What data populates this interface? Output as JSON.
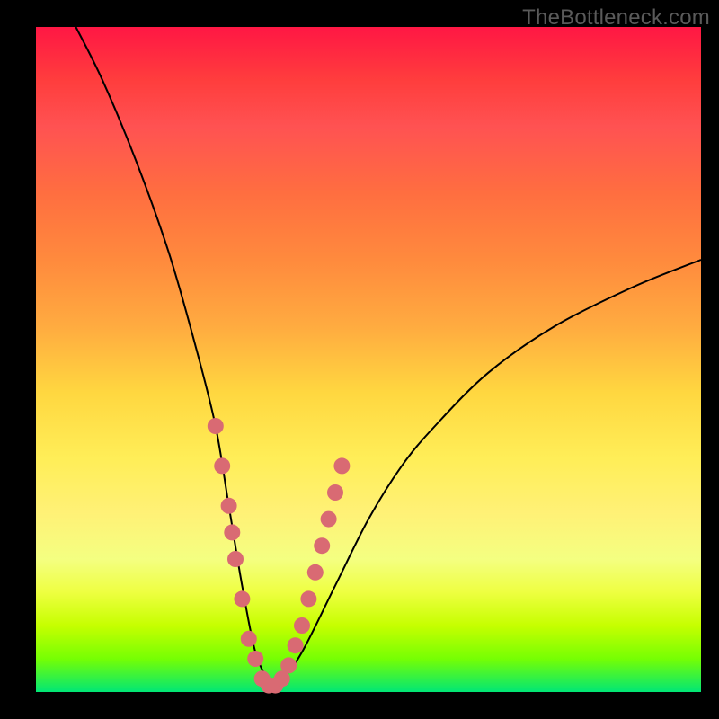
{
  "watermark": "TheBottleneck.com",
  "chart_data": {
    "type": "line",
    "title": "",
    "xlabel": "",
    "ylabel": "",
    "xlim": [
      0,
      100
    ],
    "ylim": [
      0,
      100
    ],
    "series": [
      {
        "name": "bottleneck-curve",
        "x": [
          6,
          10,
          15,
          20,
          24,
          27,
          29,
          31,
          33,
          35,
          37,
          40,
          45,
          50,
          55,
          60,
          68,
          78,
          90,
          100
        ],
        "y": [
          100,
          92,
          80,
          66,
          52,
          40,
          28,
          16,
          6,
          2,
          2,
          6,
          16,
          26,
          34,
          40,
          48,
          55,
          61,
          65
        ]
      }
    ],
    "markers": {
      "name": "highlighted-points",
      "color": "#d96a73",
      "x": [
        27,
        28,
        29,
        29.5,
        30,
        31,
        32,
        33,
        34,
        35,
        36,
        37,
        38,
        39,
        40,
        41,
        42,
        43,
        44,
        45,
        46
      ],
      "y": [
        40,
        34,
        28,
        24,
        20,
        14,
        8,
        5,
        2,
        1,
        1,
        2,
        4,
        7,
        10,
        14,
        18,
        22,
        26,
        30,
        34
      ]
    },
    "background_gradient": {
      "orientation": "vertical",
      "stops": [
        {
          "pos": 0.0,
          "color": "#ff1744"
        },
        {
          "pos": 0.25,
          "color": "#ff6e40"
        },
        {
          "pos": 0.55,
          "color": "#ffd740"
        },
        {
          "pos": 0.8,
          "color": "#f4ff81"
        },
        {
          "pos": 1.0,
          "color": "#00e676"
        }
      ]
    }
  }
}
